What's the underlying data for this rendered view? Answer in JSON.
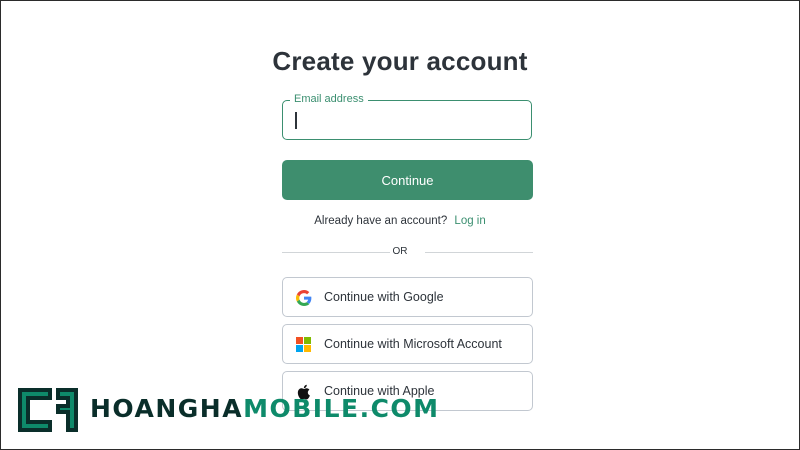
{
  "page": {
    "title": "Create your account"
  },
  "email": {
    "label": "Email address",
    "value": "",
    "placeholder": ""
  },
  "continue_button": {
    "label": "Continue"
  },
  "login": {
    "prompt": "Already have an account?",
    "link": "Log in"
  },
  "divider": {
    "label": "OR"
  },
  "social": {
    "google": {
      "label": "Continue with Google",
      "icon": "google-icon"
    },
    "microsoft": {
      "label": "Continue with Microsoft Account",
      "icon": "microsoft-icon"
    },
    "apple": {
      "label": "Continue with Apple",
      "icon": "apple-icon"
    }
  },
  "watermark": {
    "dark_text": "HOANGHA",
    "green_text": "MOBILE.COM"
  },
  "colors": {
    "accent": "#3e8e6e",
    "text": "#2d333a",
    "border": "#c2c8d0"
  }
}
